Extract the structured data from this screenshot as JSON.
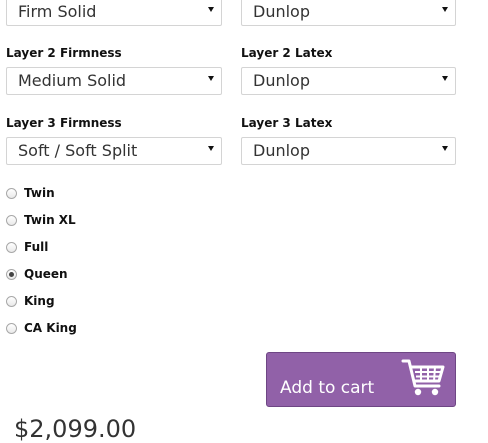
{
  "layer1": {
    "firmness_value": "Firm Solid",
    "latex_value": "Dunlop"
  },
  "layer2": {
    "firmness_label": "Layer 2 Firmness",
    "firmness_value": "Medium Solid",
    "latex_label": "Layer 2 Latex",
    "latex_value": "Dunlop"
  },
  "layer3": {
    "firmness_label": "Layer 3 Firmness",
    "firmness_value": "Soft / Soft Split",
    "latex_label": "Layer 3 Latex",
    "latex_value": "Dunlop"
  },
  "sizes": {
    "options": [
      {
        "label": "Twin",
        "checked": false
      },
      {
        "label": "Twin XL",
        "checked": false
      },
      {
        "label": "Full",
        "checked": false
      },
      {
        "label": "Queen",
        "checked": true
      },
      {
        "label": "King",
        "checked": false
      },
      {
        "label": "CA King",
        "checked": false
      }
    ]
  },
  "cart": {
    "button_label": "Add to cart",
    "icon": "shopping-cart-icon",
    "button_color": "#9161a8"
  },
  "price": {
    "value": "$2,099.00"
  }
}
